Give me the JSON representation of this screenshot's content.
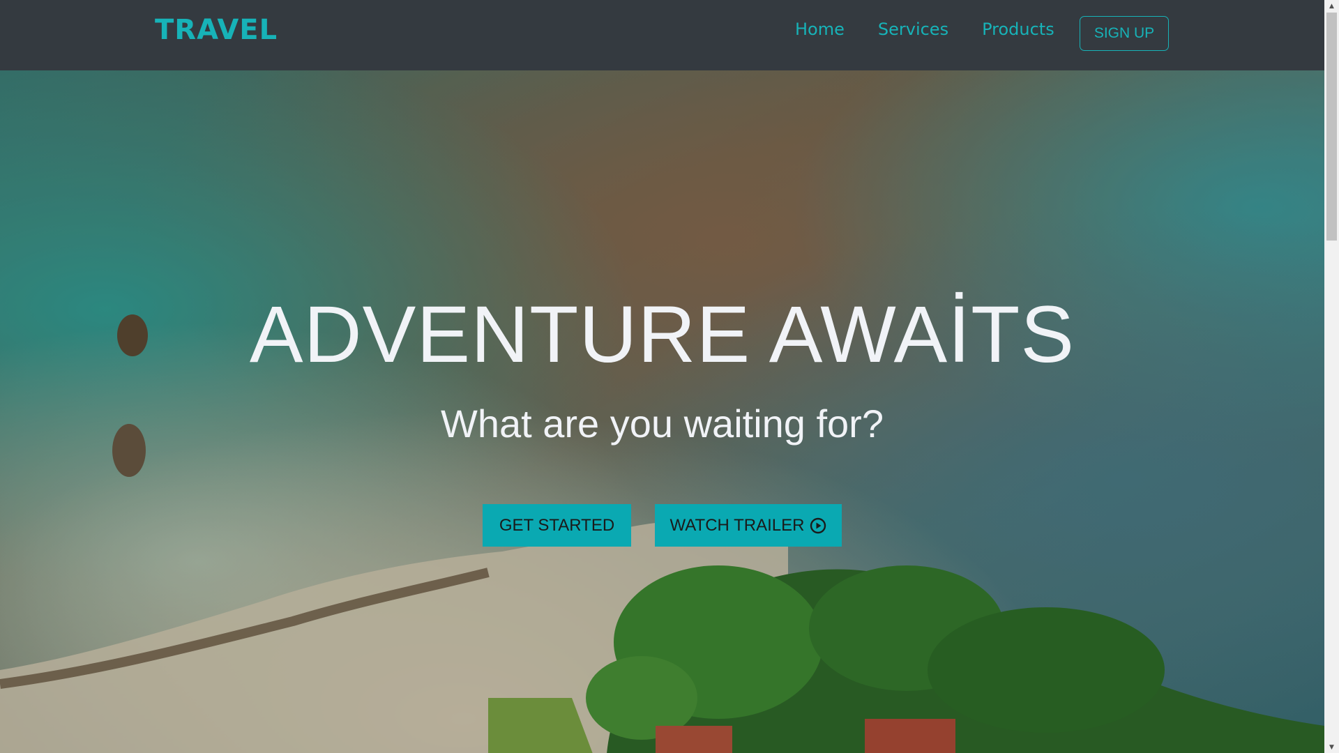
{
  "colors": {
    "accent": "#17b3b8",
    "navbar_bg": "#343a40",
    "button_bg": "#0aa9b2"
  },
  "navbar": {
    "brand": "TRAVEL",
    "links": [
      "Home",
      "Services",
      "Products"
    ],
    "signup_label": "SIGN UP"
  },
  "hero": {
    "title": "ADVENTURE AWAİTS",
    "subtitle": "What are you waiting for?",
    "get_started_label": "GET STARTED",
    "watch_trailer_label": "WATCH TRAILER",
    "trailer_icon": "play-circle-icon"
  }
}
